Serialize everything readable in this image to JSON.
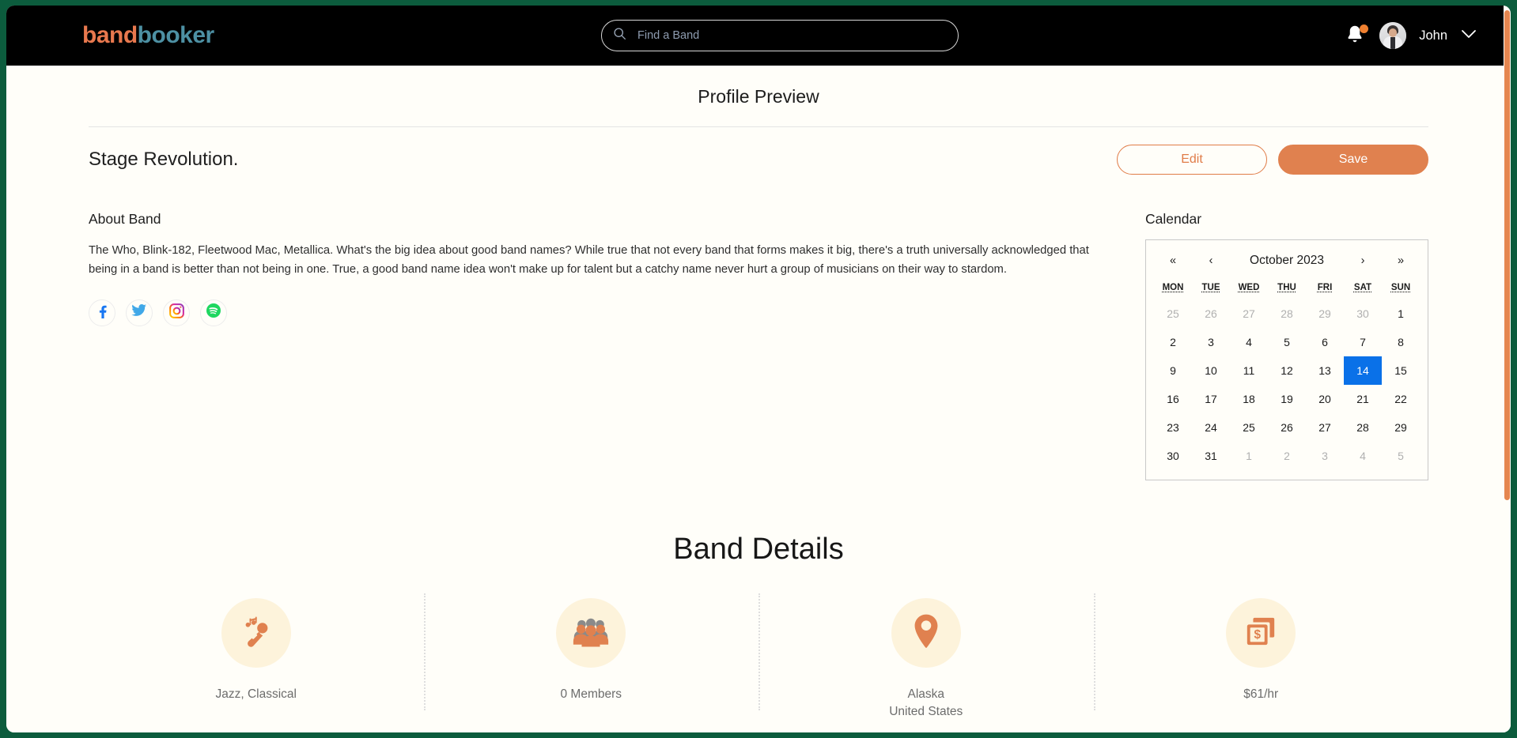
{
  "brand": {
    "part1": "band",
    "part2": "booker",
    "color1": "#e8784e",
    "color2": "#4d90a3"
  },
  "search": {
    "placeholder": "Find a Band",
    "value": "",
    "icon": "search-icon"
  },
  "nav": {
    "bell_icon": "bell-icon",
    "has_notification": true,
    "username": "John",
    "chevron": "chevron-down-icon"
  },
  "page": {
    "title": "Profile Preview",
    "band_name": "Stage Revolution.",
    "edit_label": "Edit",
    "save_label": "Save",
    "accent_color": "#e0814f"
  },
  "about": {
    "heading": "About Band",
    "text": "The Who, Blink-182, Fleetwood Mac, Metallica. What's the big idea about good band names? While true that not every band that forms makes it big, there's a truth universally acknowledged that being in a band is better than not being in one. True, a good band name idea won't make up for talent but a catchy name never hurt a group of musicians on their way to stardom.",
    "socials": [
      {
        "name": "facebook-icon",
        "label": "Facebook",
        "color": "#1877f2"
      },
      {
        "name": "twitter-icon",
        "label": "Twitter",
        "color": "#40a8e8"
      },
      {
        "name": "instagram-icon",
        "label": "Instagram",
        "color": "#d6249f"
      },
      {
        "name": "spotify-icon",
        "label": "Spotify",
        "color": "#1ed760"
      }
    ]
  },
  "calendar": {
    "heading": "Calendar",
    "nav": {
      "first": "«",
      "prev": "‹",
      "next": "›",
      "last": "»"
    },
    "month_label": "October 2023",
    "weekdays": [
      "MON",
      "TUE",
      "WED",
      "THU",
      "FRI",
      "SAT",
      "SUN"
    ],
    "selected_day": 14,
    "selected_color": "#0a71e8",
    "weeks": [
      [
        {
          "d": "25",
          "m": true
        },
        {
          "d": "26",
          "m": true
        },
        {
          "d": "27",
          "m": true
        },
        {
          "d": "28",
          "m": true
        },
        {
          "d": "29",
          "m": true
        },
        {
          "d": "30",
          "m": true
        },
        {
          "d": "1",
          "m": false
        }
      ],
      [
        {
          "d": "2",
          "m": false
        },
        {
          "d": "3",
          "m": false
        },
        {
          "d": "4",
          "m": false
        },
        {
          "d": "5",
          "m": false
        },
        {
          "d": "6",
          "m": false
        },
        {
          "d": "7",
          "m": false
        },
        {
          "d": "8",
          "m": false
        }
      ],
      [
        {
          "d": "9",
          "m": false
        },
        {
          "d": "10",
          "m": false
        },
        {
          "d": "11",
          "m": false
        },
        {
          "d": "12",
          "m": false
        },
        {
          "d": "13",
          "m": false
        },
        {
          "d": "14",
          "m": false,
          "sel": true
        },
        {
          "d": "15",
          "m": false
        }
      ],
      [
        {
          "d": "16",
          "m": false
        },
        {
          "d": "17",
          "m": false
        },
        {
          "d": "18",
          "m": false
        },
        {
          "d": "19",
          "m": false
        },
        {
          "d": "20",
          "m": false
        },
        {
          "d": "21",
          "m": false
        },
        {
          "d": "22",
          "m": false
        }
      ],
      [
        {
          "d": "23",
          "m": false
        },
        {
          "d": "24",
          "m": false
        },
        {
          "d": "25",
          "m": false
        },
        {
          "d": "26",
          "m": false
        },
        {
          "d": "27",
          "m": false
        },
        {
          "d": "28",
          "m": false
        },
        {
          "d": "29",
          "m": false
        }
      ],
      [
        {
          "d": "30",
          "m": false
        },
        {
          "d": "31",
          "m": false
        },
        {
          "d": "1",
          "m": true
        },
        {
          "d": "2",
          "m": true
        },
        {
          "d": "3",
          "m": true
        },
        {
          "d": "4",
          "m": true
        },
        {
          "d": "5",
          "m": true
        }
      ]
    ]
  },
  "details": {
    "heading": "Band Details",
    "items": [
      {
        "icon": "microphone-music-icon",
        "label": "Jazz, Classical",
        "sub": ""
      },
      {
        "icon": "members-group-icon",
        "label": "0 Members",
        "sub": ""
      },
      {
        "icon": "location-pin-icon",
        "label": "Alaska",
        "sub": "United States"
      },
      {
        "icon": "money-bills-icon",
        "label": "$61/hr",
        "sub": ""
      }
    ],
    "icon_color": "#e0814f",
    "icon_bg": "#fdf3db"
  }
}
